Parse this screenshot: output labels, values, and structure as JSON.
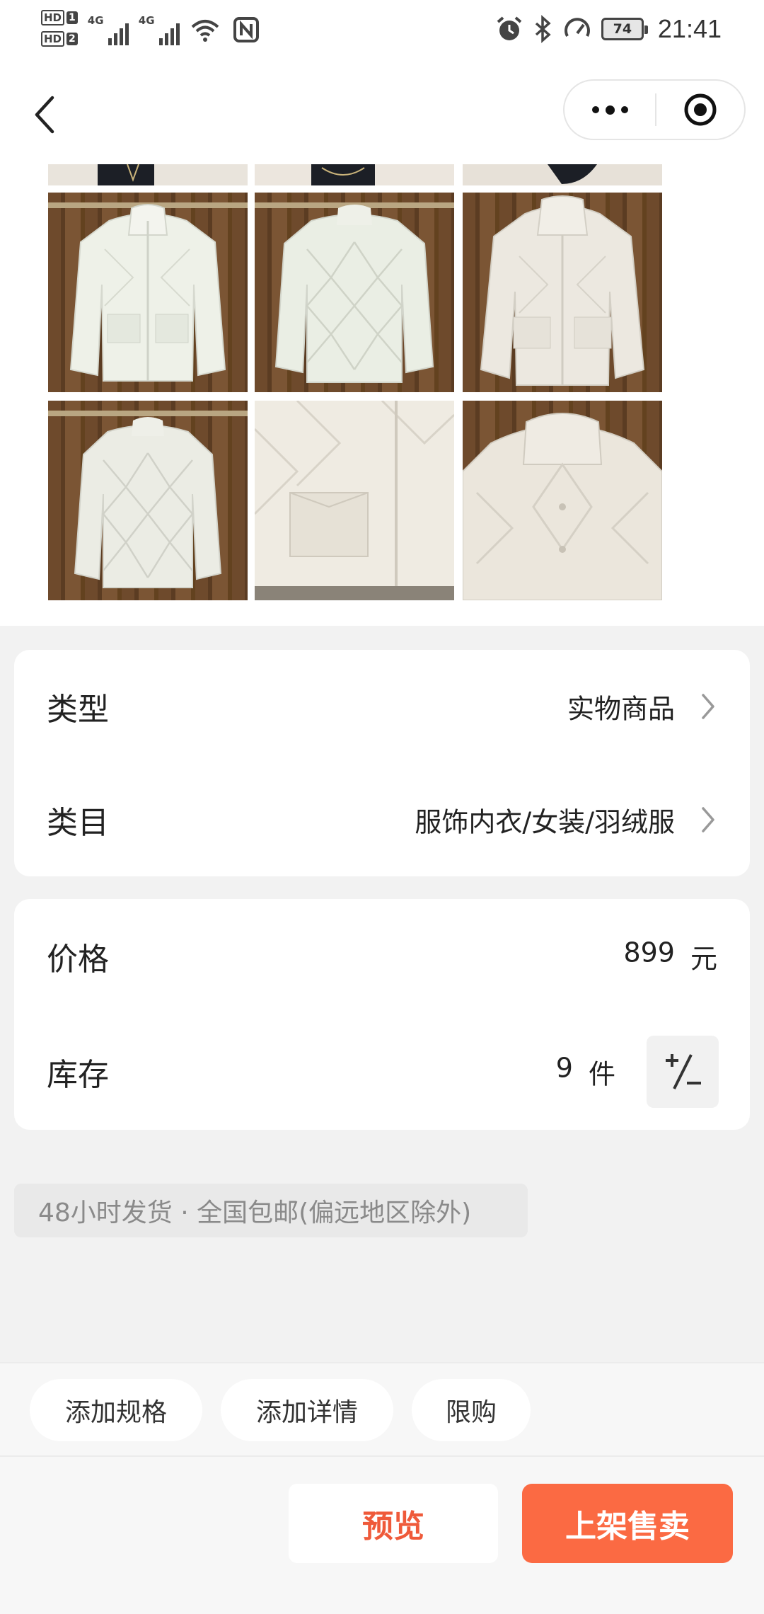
{
  "status_bar": {
    "sim1_label": "HD",
    "sim1_num": "1",
    "sim2_label": "HD",
    "sim2_num": "2",
    "sig1_gen": "4G",
    "sig2_gen": "4G",
    "battery": "74",
    "time": "21:41",
    "icons": [
      "alarm-icon",
      "bluetooth-icon",
      "speedometer-icon",
      "wifi-icon",
      "nfc-icon"
    ]
  },
  "nav": {
    "back_icon": "chevron-left-icon",
    "more_icon": "more-dots-icon",
    "close_icon": "target-icon"
  },
  "gallery": {
    "images": [
      {
        "name": "jacket-front-hanger",
        "alt": "jacket-front"
      },
      {
        "name": "jacket-back-hanger",
        "alt": "jacket-back"
      },
      {
        "name": "jacket-front-open",
        "alt": "jacket-front-open"
      },
      {
        "name": "jacket-back-2",
        "alt": "jacket-back-2"
      },
      {
        "name": "jacket-closeup-pocket",
        "alt": "jacket-pocket"
      },
      {
        "name": "jacket-collar-closeup",
        "alt": "jacket-collar"
      }
    ]
  },
  "product_info": {
    "type_label": "类型",
    "type_value": "实物商品",
    "category_label": "类目",
    "category_value": "服饰内衣/女装/羽绒服"
  },
  "pricing": {
    "price_label": "价格",
    "price_value": "899",
    "price_unit": "元",
    "stock_label": "库存",
    "stock_value": "9",
    "stock_unit": "件"
  },
  "shipping_note": "48小时发货 · 全国包邮(偏远地区除外)",
  "chips": {
    "add_spec": "添加规格",
    "add_detail": "添加详情",
    "limit": "限购"
  },
  "actions": {
    "preview": "预览",
    "publish": "上架售卖"
  },
  "colors": {
    "accent": "#fb6a43",
    "accent_text": "#ef5a3a",
    "background": "#f2f2f2"
  }
}
